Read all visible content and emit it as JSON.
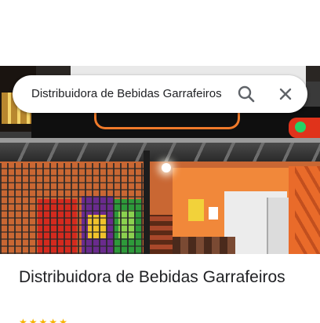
{
  "search": {
    "query": "Distribuidora de Bebidas Garrafeiros",
    "search_icon": "search-icon",
    "close_icon": "close-icon"
  },
  "photo": {
    "description_icon": "storefront-photo"
  },
  "place": {
    "title": "Distribuidora de Bebidas Garrafeiros"
  },
  "colors": {
    "star": "#f6b400",
    "text": "#202124",
    "icon": "#5f6368"
  }
}
